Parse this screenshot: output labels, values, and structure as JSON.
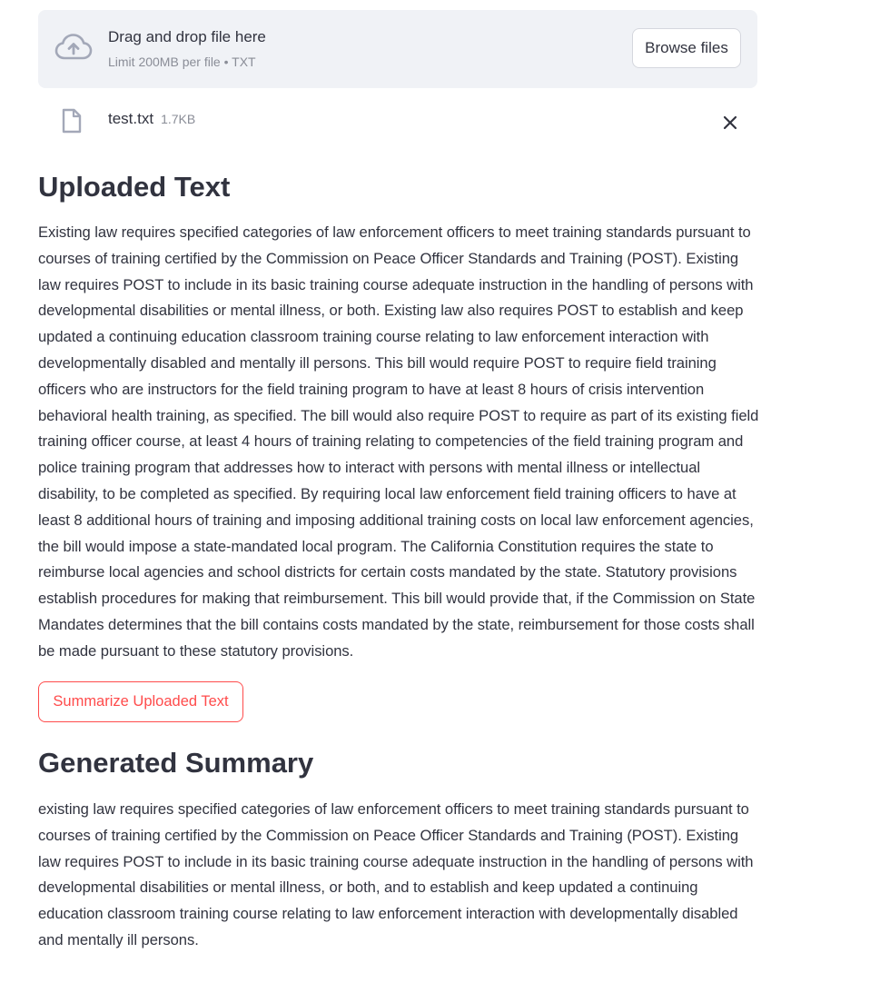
{
  "uploader": {
    "title": "Drag and drop file here",
    "limits": "Limit 200MB per file • TXT",
    "browse_label": "Browse files",
    "icon": "cloud-upload-icon"
  },
  "file": {
    "name": "test.txt",
    "size": "1.7KB",
    "icon": "file-icon",
    "remove_icon": "close-icon"
  },
  "uploaded_section": {
    "heading": "Uploaded Text",
    "text": "Existing law requires specified categories of law enforcement officers to meet training standards pursuant to courses of training certified by the Commission on Peace Officer Standards and Training (POST). Existing law requires POST to include in its basic training course adequate instruction in the handling of persons with developmental disabilities or mental illness, or both. Existing law also requires POST to establish and keep updated a continuing education classroom training course relating to law enforcement interaction with developmentally disabled and mentally ill persons. This bill would require POST to require field training officers who are instructors for the field training program to have at least 8 hours of crisis intervention behavioral health training, as specified. The bill would also require POST to require as part of its existing field training officer course, at least 4 hours of training relating to competencies of the field training program and police training program that addresses how to interact with persons with mental illness or intellectual disability, to be completed as specified. By requiring local law enforcement field training officers to have at least 8 additional hours of training and imposing additional training costs on local law enforcement agencies, the bill would impose a state-mandated local program. The California Constitution requires the state to reimburse local agencies and school districts for certain costs mandated by the state. Statutory provisions establish procedures for making that reimbursement. This bill would provide that, if the Commission on State Mandates determines that the bill contains costs mandated by the state, reimbursement for those costs shall be made pursuant to these statutory provisions."
  },
  "summarize_button": {
    "label": "Summarize Uploaded Text"
  },
  "summary_section": {
    "heading": "Generated Summary",
    "text": "existing law requires specified categories of law enforcement officers to meet training standards pursuant to courses of training certified by the Commission on Peace Officer Standards and Training (POST). Existing law requires POST to include in its basic training course adequate instruction in the handling of persons with developmental disabilities or mental illness, or both, and to establish and keep updated a continuing education classroom training course relating to law enforcement interaction with developmentally disabled and mentally ill persons."
  },
  "colors": {
    "accent": "#ff4b4b",
    "text": "#31333f",
    "muted": "#8a8d97",
    "uploader_bg": "#f0f2f6"
  }
}
